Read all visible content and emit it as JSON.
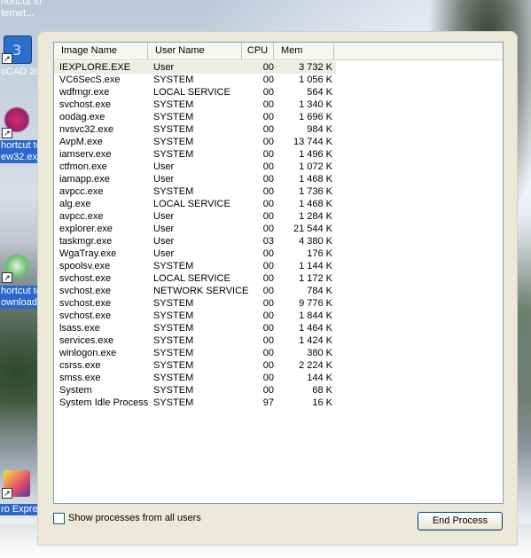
{
  "desktop": {
    "icons": [
      {
        "label_lines": [
          "hortcut to",
          "ternet..."
        ],
        "icon": "internet-shortcut-icon"
      },
      {
        "label_lines": [
          "oCAD 20"
        ],
        "icon": "autocad-icon"
      },
      {
        "label_lines": [
          "hortcut to",
          "ew32.ex"
        ],
        "icon": "puzzle-app-icon"
      },
      {
        "label_lines": [
          "hortcut to",
          "ownload"
        ],
        "icon": "recycle-download-icon"
      },
      {
        "label_lines": [
          "ro Expres"
        ],
        "icon": "express-app-icon"
      }
    ]
  },
  "taskmgr": {
    "columns": [
      "Image Name",
      "User Name",
      "CPU",
      "Mem Usage"
    ],
    "processes": [
      {
        "name": "IEXPLORE.EXE",
        "user": "User",
        "cpu": "00",
        "mem": "3 732 K"
      },
      {
        "name": "VC6SecS.exe",
        "user": "SYSTEM",
        "cpu": "00",
        "mem": "1 056 K"
      },
      {
        "name": "wdfmgr.exe",
        "user": "LOCAL SERVICE",
        "cpu": "00",
        "mem": "564 K"
      },
      {
        "name": "svchost.exe",
        "user": "SYSTEM",
        "cpu": "00",
        "mem": "1 340 K"
      },
      {
        "name": "oodag.exe",
        "user": "SYSTEM",
        "cpu": "00",
        "mem": "1 696 K"
      },
      {
        "name": "nvsvc32.exe",
        "user": "SYSTEM",
        "cpu": "00",
        "mem": "984 K"
      },
      {
        "name": "AvpM.exe",
        "user": "SYSTEM",
        "cpu": "00",
        "mem": "13 744 K"
      },
      {
        "name": "iamserv.exe",
        "user": "SYSTEM",
        "cpu": "00",
        "mem": "1 496 K"
      },
      {
        "name": "ctfmon.exe",
        "user": "User",
        "cpu": "00",
        "mem": "1 072 K"
      },
      {
        "name": "iamapp.exe",
        "user": "User",
        "cpu": "00",
        "mem": "1 468 K"
      },
      {
        "name": "avpcc.exe",
        "user": "SYSTEM",
        "cpu": "00",
        "mem": "1 736 K"
      },
      {
        "name": "alg.exe",
        "user": "LOCAL SERVICE",
        "cpu": "00",
        "mem": "1 468 K"
      },
      {
        "name": "avpcc.exe",
        "user": "User",
        "cpu": "00",
        "mem": "1 284 K"
      },
      {
        "name": "explorer.exe",
        "user": "User",
        "cpu": "00",
        "mem": "21 544 K"
      },
      {
        "name": "taskmgr.exe",
        "user": "User",
        "cpu": "03",
        "mem": "4 380 K"
      },
      {
        "name": "WgaTray.exe",
        "user": "User",
        "cpu": "00",
        "mem": "176 K"
      },
      {
        "name": "spoolsv.exe",
        "user": "SYSTEM",
        "cpu": "00",
        "mem": "1 144 K"
      },
      {
        "name": "svchost.exe",
        "user": "LOCAL SERVICE",
        "cpu": "00",
        "mem": "1 172 K"
      },
      {
        "name": "svchost.exe",
        "user": "NETWORK SERVICE",
        "cpu": "00",
        "mem": "784 K"
      },
      {
        "name": "svchost.exe",
        "user": "SYSTEM",
        "cpu": "00",
        "mem": "9 776 K"
      },
      {
        "name": "svchost.exe",
        "user": "SYSTEM",
        "cpu": "00",
        "mem": "1 844 K"
      },
      {
        "name": "lsass.exe",
        "user": "SYSTEM",
        "cpu": "00",
        "mem": "1 464 K"
      },
      {
        "name": "services.exe",
        "user": "SYSTEM",
        "cpu": "00",
        "mem": "1 424 K"
      },
      {
        "name": "winlogon.exe",
        "user": "SYSTEM",
        "cpu": "00",
        "mem": "380 K"
      },
      {
        "name": "csrss.exe",
        "user": "SYSTEM",
        "cpu": "00",
        "mem": "2 224 K"
      },
      {
        "name": "smss.exe",
        "user": "SYSTEM",
        "cpu": "00",
        "mem": "144 K"
      },
      {
        "name": "System",
        "user": "SYSTEM",
        "cpu": "00",
        "mem": "68 K"
      },
      {
        "name": "System Idle Process",
        "user": "SYSTEM",
        "cpu": "97",
        "mem": "16 K"
      }
    ],
    "selected_index": 0,
    "show_all_label": "Show processes from all users",
    "show_all_checked": false,
    "end_process_label": "End Process"
  },
  "colors": {
    "panel_bg": "#ece9d8",
    "list_border": "#7f9db9",
    "selection_bg": "#2e66cc"
  }
}
